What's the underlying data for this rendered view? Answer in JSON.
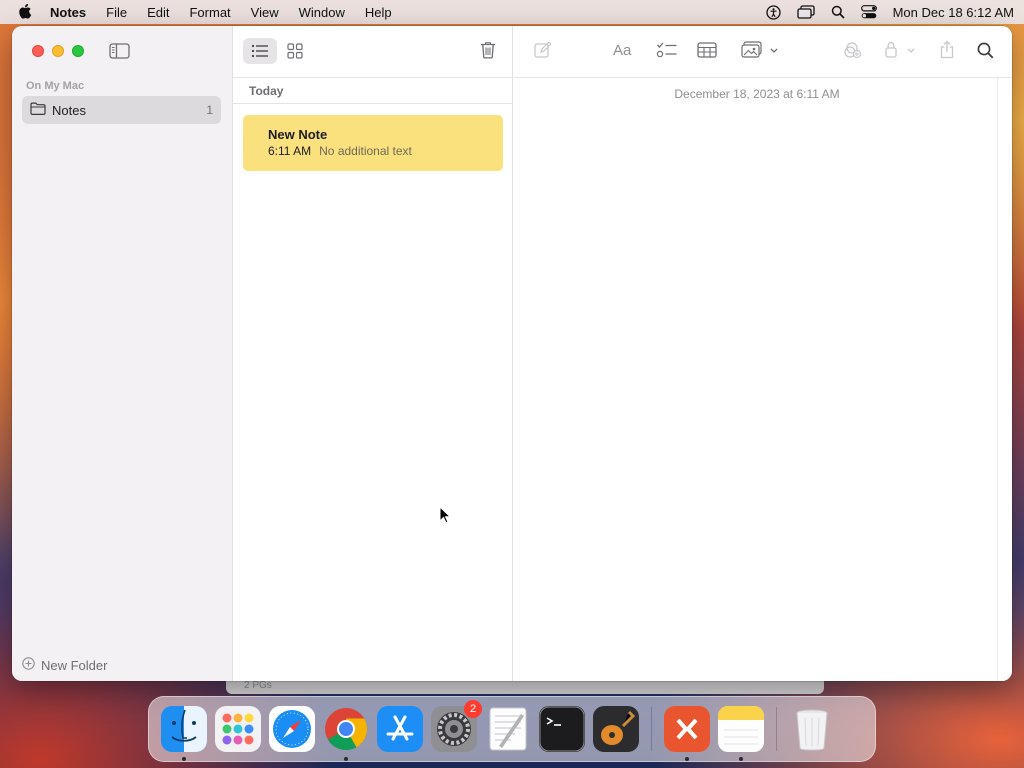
{
  "menubar": {
    "app_name": "Notes",
    "menus": [
      "File",
      "Edit",
      "Format",
      "View",
      "Window",
      "Help"
    ],
    "clock": "Mon Dec 18  6:12 AM"
  },
  "sidebar": {
    "section_label": "On My Mac",
    "folders": [
      {
        "label": "Notes",
        "count": "1"
      }
    ],
    "new_folder_label": "New Folder"
  },
  "note_list": {
    "group_header": "Today",
    "notes": [
      {
        "title": "New Note",
        "time": "6:11 AM",
        "preview": "No additional text",
        "highlight_color": "#fbe07e"
      }
    ]
  },
  "editor": {
    "date_text": "December 18, 2023 at 6:11 AM"
  },
  "background_window": {
    "title_fragment": "2 PGs"
  },
  "dock": {
    "apps": [
      {
        "name": "Finder",
        "running": true
      },
      {
        "name": "Launchpad",
        "running": false
      },
      {
        "name": "Safari",
        "running": false
      },
      {
        "name": "Google Chrome",
        "running": true
      },
      {
        "name": "App Store",
        "running": false
      },
      {
        "name": "System Settings",
        "running": false,
        "badge": "2"
      },
      {
        "name": "TextEdit",
        "running": false
      },
      {
        "name": "Terminal",
        "running": false
      },
      {
        "name": "GarageBand",
        "running": false
      },
      {
        "name": "Microsoft Remote Desktop",
        "running": true
      },
      {
        "name": "Notes",
        "running": true
      },
      {
        "name": "Trash",
        "running": false
      }
    ]
  },
  "colors": {
    "accent_note": "#fbe07e",
    "close": "#ff5f57",
    "minimize": "#febc2e",
    "maximize": "#28c840"
  }
}
